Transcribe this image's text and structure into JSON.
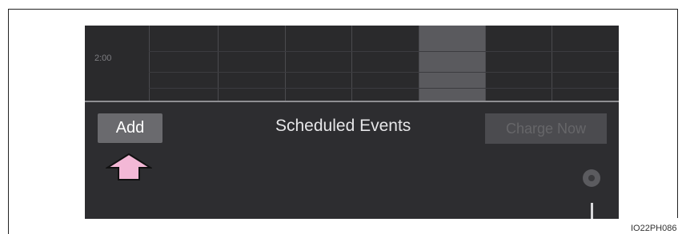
{
  "calendar": {
    "time_label": "2:00",
    "highlighted_column": 5,
    "columns": 8
  },
  "toolbar": {
    "add_label": "Add",
    "title": "Scheduled Events",
    "charge_now_label": "Charge Now",
    "charge_now_enabled": false
  },
  "icons": {
    "pointer": "up-arrow-icon",
    "info": "info-circle-icon"
  },
  "figure": {
    "code": "IO22PH086"
  },
  "colors": {
    "screen_background": "#2b2b2d",
    "highlight_column": "#5a5a5e",
    "add_button": "#6a6a6e",
    "arrow_fill": "#f3b8d6",
    "title_text": "#e6e6e8"
  }
}
